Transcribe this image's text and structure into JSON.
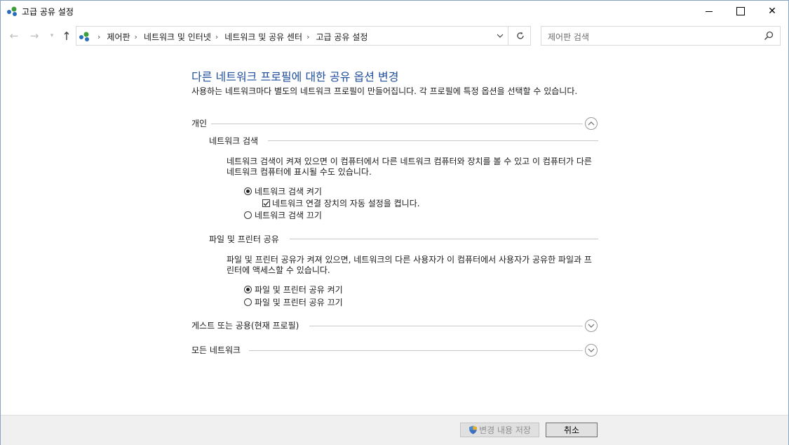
{
  "window": {
    "title": "고급 공유 설정",
    "minimize": "—",
    "close": "✕"
  },
  "address_bar": {
    "breadcrumbs": [
      "제어판",
      "네트워크 및 인터넷",
      "네트워크 및 공유 센터",
      "고급 공유 설정"
    ],
    "separator": "›"
  },
  "search": {
    "placeholder": "제어판 검색"
  },
  "page": {
    "heading": "다른 네트워크 프로필에 대한 공유 옵션 변경",
    "description": "사용하는 네트워크마다 별도의 네트워크 프로필이 만들어집니다. 각 프로필에 특정 옵션을 선택할 수 있습니다."
  },
  "private": {
    "label": "개인",
    "expanded": true,
    "discovery": {
      "label": "네트워크 검색",
      "description": "네트워크 검색이 켜져 있으면 이 컴퓨터에서 다른 네트워크 컴퓨터와 장치를 볼 수 있고 이 컴퓨터가 다른 네트워크 컴퓨터에 표시될 수도 있습니다.",
      "on_label": "네트워크 검색 켜기",
      "auto_setup_label": "네트워크 연결 장치의 자동 설정을 켭니다.",
      "off_label": "네트워크 검색 끄기",
      "selected": "on",
      "auto_setup_checked": true
    },
    "file_sharing": {
      "label": "파일 및 프린터 공유",
      "description": "파일 및 프린터 공유가 켜져 있으면, 네트워크의 다른 사용자가 이 컴퓨터에서 사용자가 공유한 파일과 프린터에 액세스할 수 있습니다.",
      "on_label": "파일 및 프린터 공유 켜기",
      "off_label": "파일 및 프린터 공유 끄기",
      "selected": "on"
    }
  },
  "guest_public": {
    "label": "게스트 또는 공용(현재 프로필)",
    "expanded": false
  },
  "all_networks": {
    "label": "모든 네트워크",
    "expanded": false
  },
  "footer": {
    "save_label": "변경 내용 저장",
    "cancel_label": "취소"
  }
}
